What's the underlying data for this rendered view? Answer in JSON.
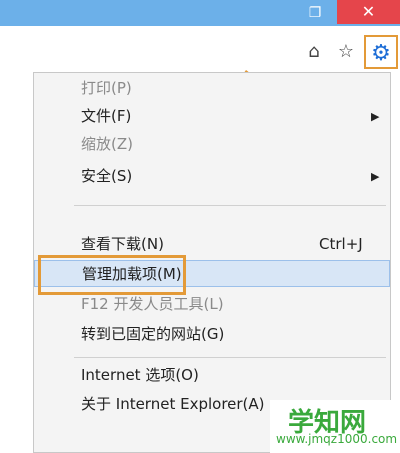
{
  "window": {
    "restore_icon": "restore-icon",
    "close_icon": "close-icon"
  },
  "toolbar": {
    "icons": [
      "home-icon",
      "star-icon",
      "gear-icon"
    ]
  },
  "menu": {
    "items": [
      {
        "label": "打印(P)",
        "disabled": true
      },
      {
        "label": "文件(F)",
        "has_submenu": true
      },
      {
        "label": "缩放(Z)",
        "disabled": true
      },
      {
        "label": "安全(S)",
        "has_submenu": true
      },
      {
        "label": "查看下载(N)",
        "shortcut": "Ctrl+J"
      },
      {
        "label": "管理加载项(M)",
        "highlighted": true
      },
      {
        "label": "F12 开发人员工具(L)",
        "disabled": true
      },
      {
        "label": "转到已固定的网站(G)"
      },
      {
        "label": "Internet 选项(O)"
      },
      {
        "label": "关于 Internet Explorer(A)"
      }
    ]
  },
  "watermark": {
    "title": "学知网",
    "url": "www.jmqz1000.com"
  },
  "colors": {
    "accent_orange": "#e39a38",
    "close_red": "#e5454b",
    "title_blue": "#6cb0e9",
    "gear_blue": "#1d6dd6",
    "watermark_green": "#3aa93c"
  }
}
